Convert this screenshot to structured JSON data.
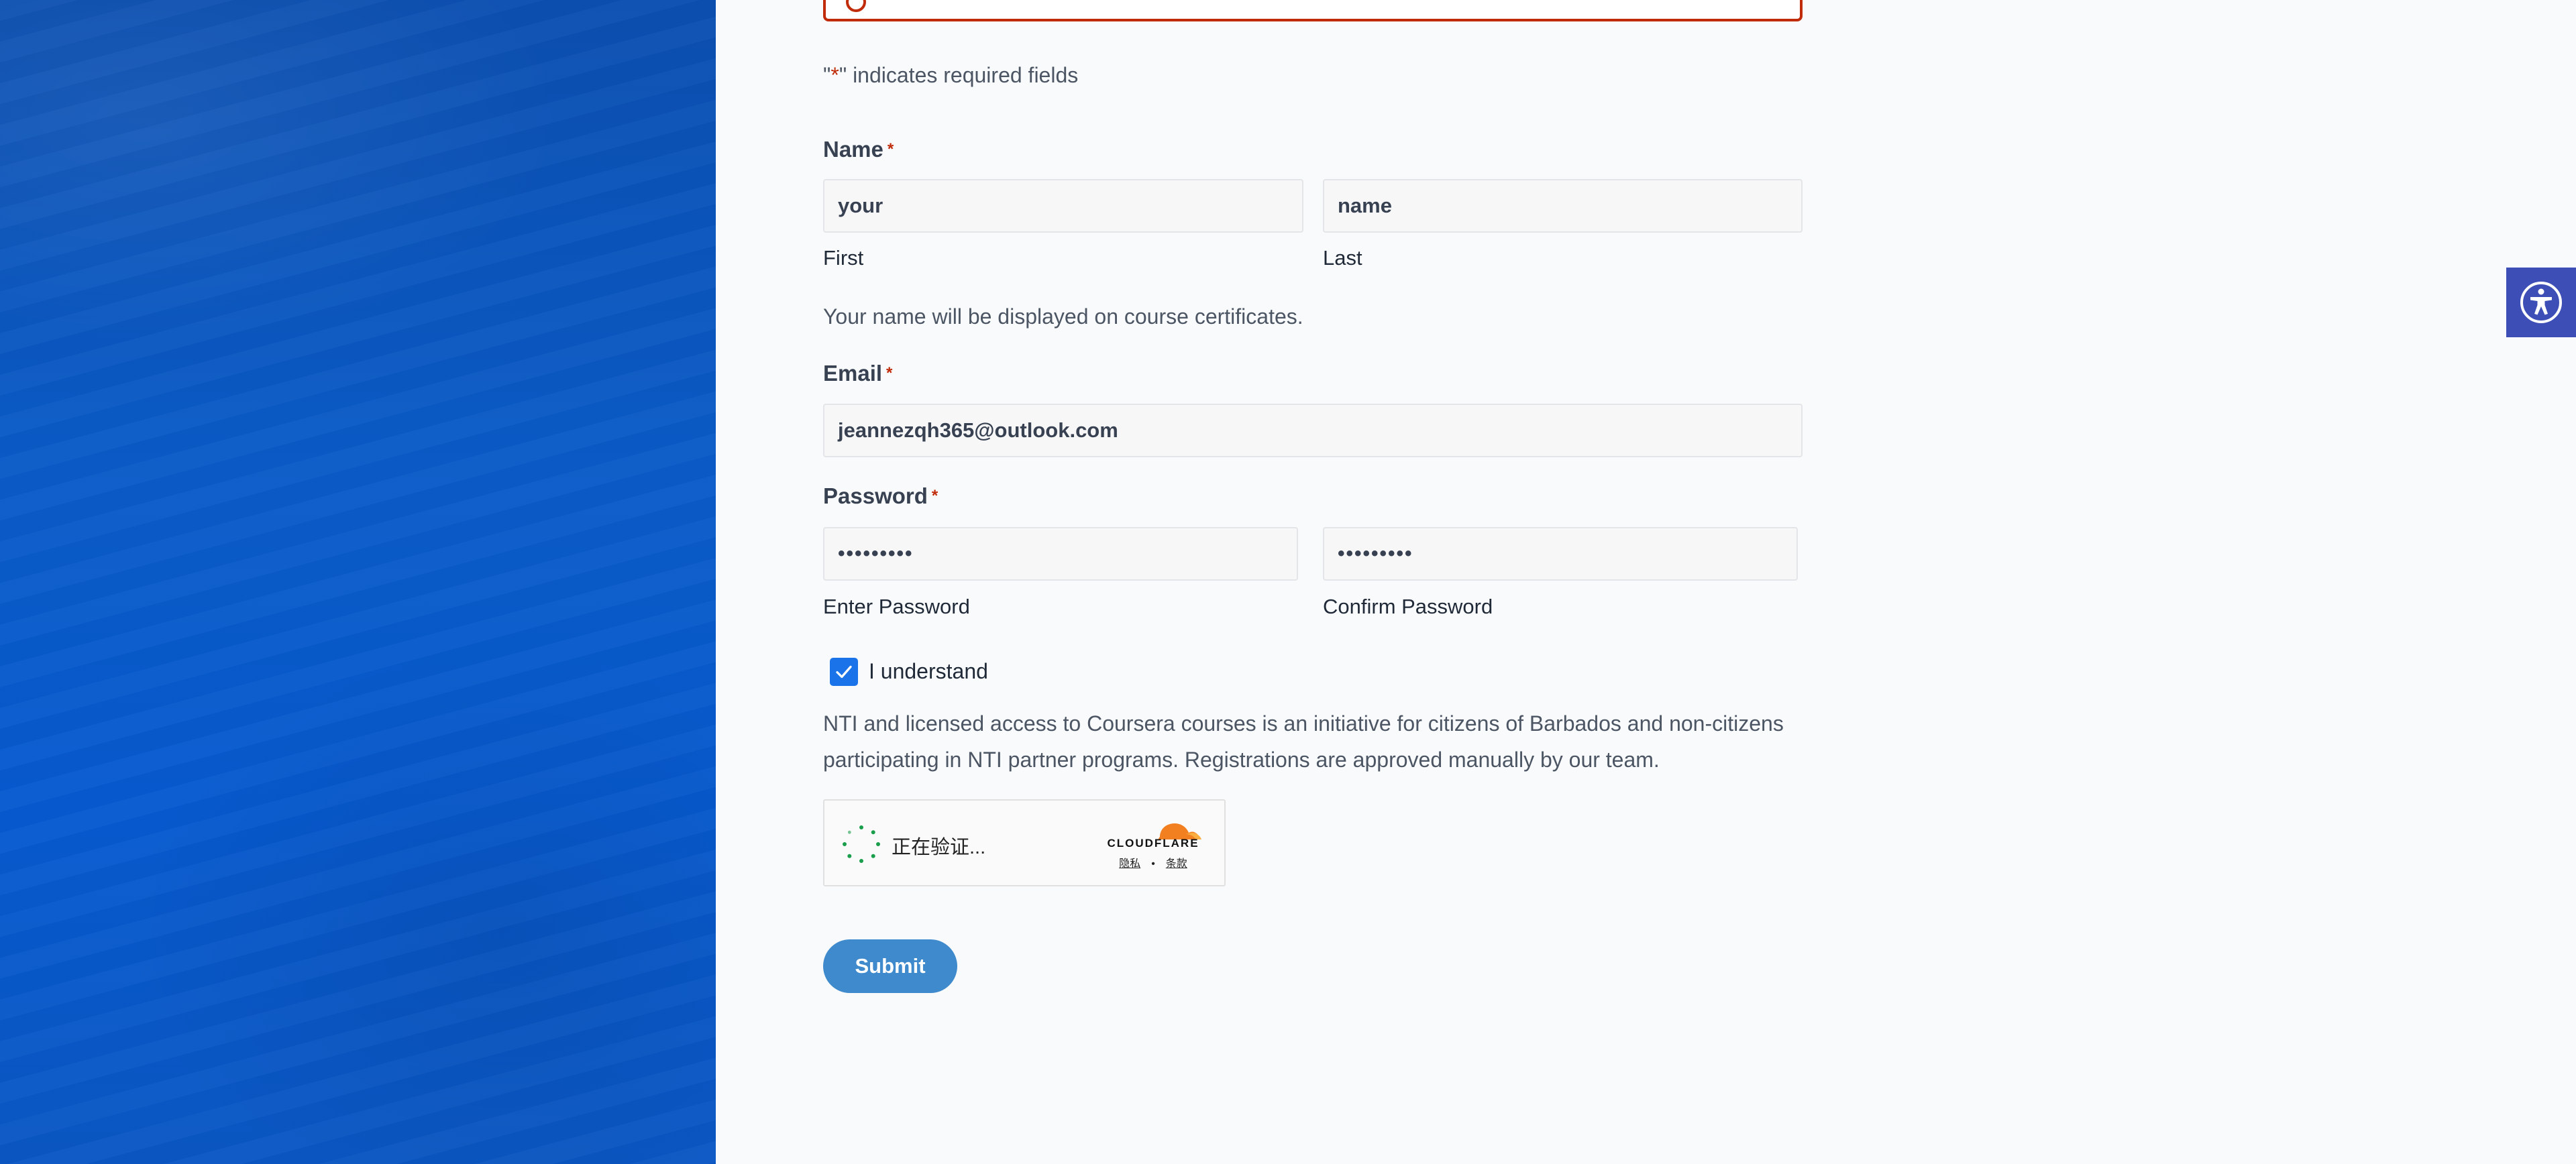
{
  "form": {
    "required_note_prefix": "\"",
    "required_note_star": "*",
    "required_note_suffix": "\" indicates required fields",
    "name": {
      "label": "Name",
      "required_marker": "*",
      "first_value": "your",
      "last_value": "name",
      "first_sublabel": "First",
      "last_sublabel": "Last",
      "hint": "Your name will be displayed on course certificates."
    },
    "email": {
      "label": "Email",
      "required_marker": "*",
      "value": "jeannezqh365@outlook.com"
    },
    "password": {
      "label": "Password",
      "required_marker": "*",
      "enter_value": "•••••••••",
      "confirm_value": "•••••••••",
      "enter_sublabel": "Enter Password",
      "confirm_sublabel": "Confirm Password"
    },
    "consent": {
      "checked": true,
      "label": "I understand"
    },
    "notice": "NTI and licensed access to Coursera courses is an initiative for citizens of Barbados and non-citizens participating in NTI partner programs. Registrations are approved manually by our team.",
    "captcha": {
      "status": "正在验证...",
      "brand": "CLOUDFLARE",
      "privacy_link": "隐私",
      "separator": "•",
      "terms_link": "条款"
    },
    "submit_label": "Submit"
  },
  "icons": {
    "accessibility": "accessibility-icon",
    "checkbox": "checkmark-icon",
    "error": "error-circle-icon",
    "spinner": "loading-spinner-icon",
    "cloudflare": "cloudflare-cloud-icon"
  },
  "colors": {
    "side_panel": "#0a5bc8",
    "required": "#c02b0a",
    "checkbox": "#1a73e8",
    "submit": "#3e8acc",
    "accessibility_button": "#3d4fb6"
  }
}
